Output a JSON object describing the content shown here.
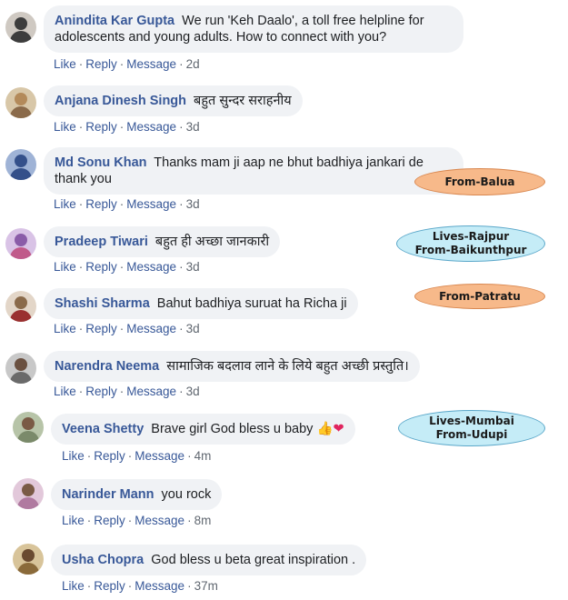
{
  "comments": [
    {
      "name": "Anindita Kar Gupta",
      "text": "We run 'Keh Daalo', a toll free helpline for adolescents and young adults. How to connect with you?",
      "like": "Like",
      "reply": "Reply",
      "message": "Message",
      "time": "2d",
      "avatar_color": "#3d3d3d"
    },
    {
      "name": "Anjana Dinesh Singh",
      "text": "बहुत सुन्दर सराहनीय",
      "like": "Like",
      "reply": "Reply",
      "message": "Message",
      "time": "3d",
      "avatar_color": "#b38a5a"
    },
    {
      "name": "Md Sonu Khan",
      "text": "Thanks mam ji aap ne bhut badhiya jankari de thank you",
      "like": "Like",
      "reply": "Reply",
      "message": "Message",
      "time": "3d",
      "avatar_color": "#34508a"
    },
    {
      "name": "Pradeep Tiwari",
      "text": "बहुत ही अच्छा जानकारी",
      "like": "Like",
      "reply": "Reply",
      "message": "Message",
      "time": "3d",
      "avatar_color": "#8a5ca8"
    },
    {
      "name": "Shashi Sharma",
      "text": "Bahut badhiya suruat ha Richa ji",
      "like": "Like",
      "reply": "Reply",
      "message": "Message",
      "time": "3d",
      "avatar_color": "#9a3030"
    },
    {
      "name": "Narendra Neema",
      "text": "सामाजिक बदलाव लाने के लिये बहुत अच्छी प्रस्तुति।",
      "like": "Like",
      "reply": "Reply",
      "message": "Message",
      "time": "3d",
      "avatar_color": "#6a6a6a"
    },
    {
      "name": "Veena Shetty",
      "text": "Brave girl God bless u baby",
      "emoji_thumb": "👍",
      "emoji_heart": "❤",
      "like": "Like",
      "reply": "Reply",
      "message": "Message",
      "time": "4m",
      "avatar_color": "#7a8a6a"
    },
    {
      "name": "Narinder Mann",
      "text": "you rock",
      "like": "Like",
      "reply": "Reply",
      "message": "Message",
      "time": "8m",
      "avatar_color": "#b07aa0"
    },
    {
      "name": "Usha Chopra",
      "text": "God bless u beta great inspiration .",
      "like": "Like",
      "reply": "Reply",
      "message": "Message",
      "time": "37m",
      "avatar_color": "#8a6a3a"
    }
  ],
  "tags": {
    "balua": {
      "line1": "From-Balua"
    },
    "rajpur": {
      "line1": "Lives-Rajpur",
      "line2": "From-Baikunthpur"
    },
    "patratu": {
      "line1": "From-Patratu"
    },
    "mumbai": {
      "line1": "Lives-Mumbai",
      "line2": "From-Udupi"
    }
  },
  "colors": {
    "name_blue": "#385898",
    "bubble_gray": "#f0f2f5",
    "tag_orange": "#f7b98a",
    "tag_blue": "#c5ecf7"
  }
}
